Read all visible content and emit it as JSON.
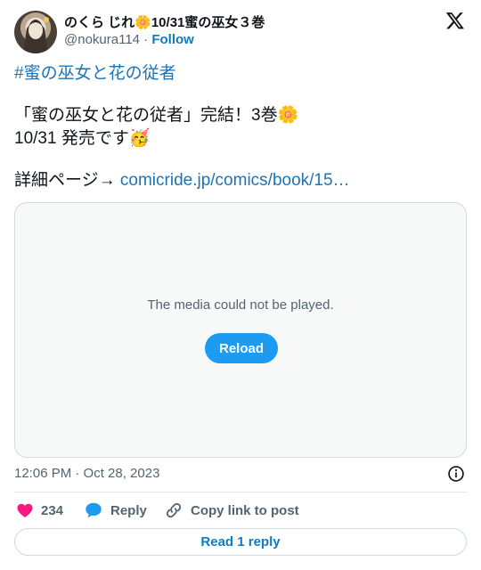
{
  "author": {
    "display_name": "のくら じれ🌼10/31蜜の巫女３巻",
    "handle": "@nokura114",
    "separator": " · ",
    "follow_label": "Follow"
  },
  "tweet": {
    "lines": [
      "#蜜の巫女と花の従者",
      "「蜜の巫女と花の従者」完結！3巻🌼",
      "10/31 発売です🥳",
      "詳細ページ→ ",
      "comicride.jp/comics/book/15…"
    ]
  },
  "media": {
    "message": "The media could not be played.",
    "reload_label": "Reload"
  },
  "meta": {
    "timestamp": "12:06 PM · Oct 28, 2023"
  },
  "actions": {
    "like_count": "234",
    "reply_label": "Reply",
    "copy_label": "Copy link to post"
  },
  "footer": {
    "read_replies_label": "Read 1 reply"
  },
  "colors": {
    "link": "#1d73b5",
    "accent": "#1d9bf0",
    "like": "#f91880",
    "muted": "#536471"
  }
}
